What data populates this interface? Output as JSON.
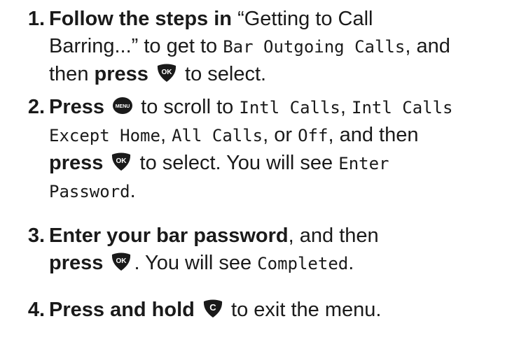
{
  "steps": [
    {
      "number": "1.",
      "lines": [
        [
          "Follow the steps in",
          "“Getting to Call"
        ],
        [
          "Barring...” to get to",
          "Bar Outgoing Calls",
          ", and"
        ],
        [
          "then",
          "press",
          "to select."
        ]
      ]
    },
    {
      "number": "2.",
      "lines": [
        [
          "Press",
          "to scroll to",
          "Intl Calls",
          ",",
          "Intl Calls"
        ],
        [
          "Except Home",
          ",",
          "All Calls",
          ", or",
          "Off",
          ", and then"
        ],
        [
          "press",
          "to select. You will see",
          "Enter"
        ],
        [
          "Password",
          "."
        ]
      ]
    },
    {
      "number": "3.",
      "lines": [
        [
          "Enter your bar password",
          ", and then"
        ],
        [
          "press",
          ". You will see",
          "Completed",
          "."
        ]
      ]
    },
    {
      "number": "4.",
      "lines": [
        [
          "Press and hold",
          "to exit the menu."
        ]
      ]
    }
  ],
  "keys": {
    "ok": "OK",
    "menu": "MENU",
    "clear": "C"
  },
  "colors": {
    "key_fill": "#1a1a1a",
    "key_text": "#ffffff"
  }
}
